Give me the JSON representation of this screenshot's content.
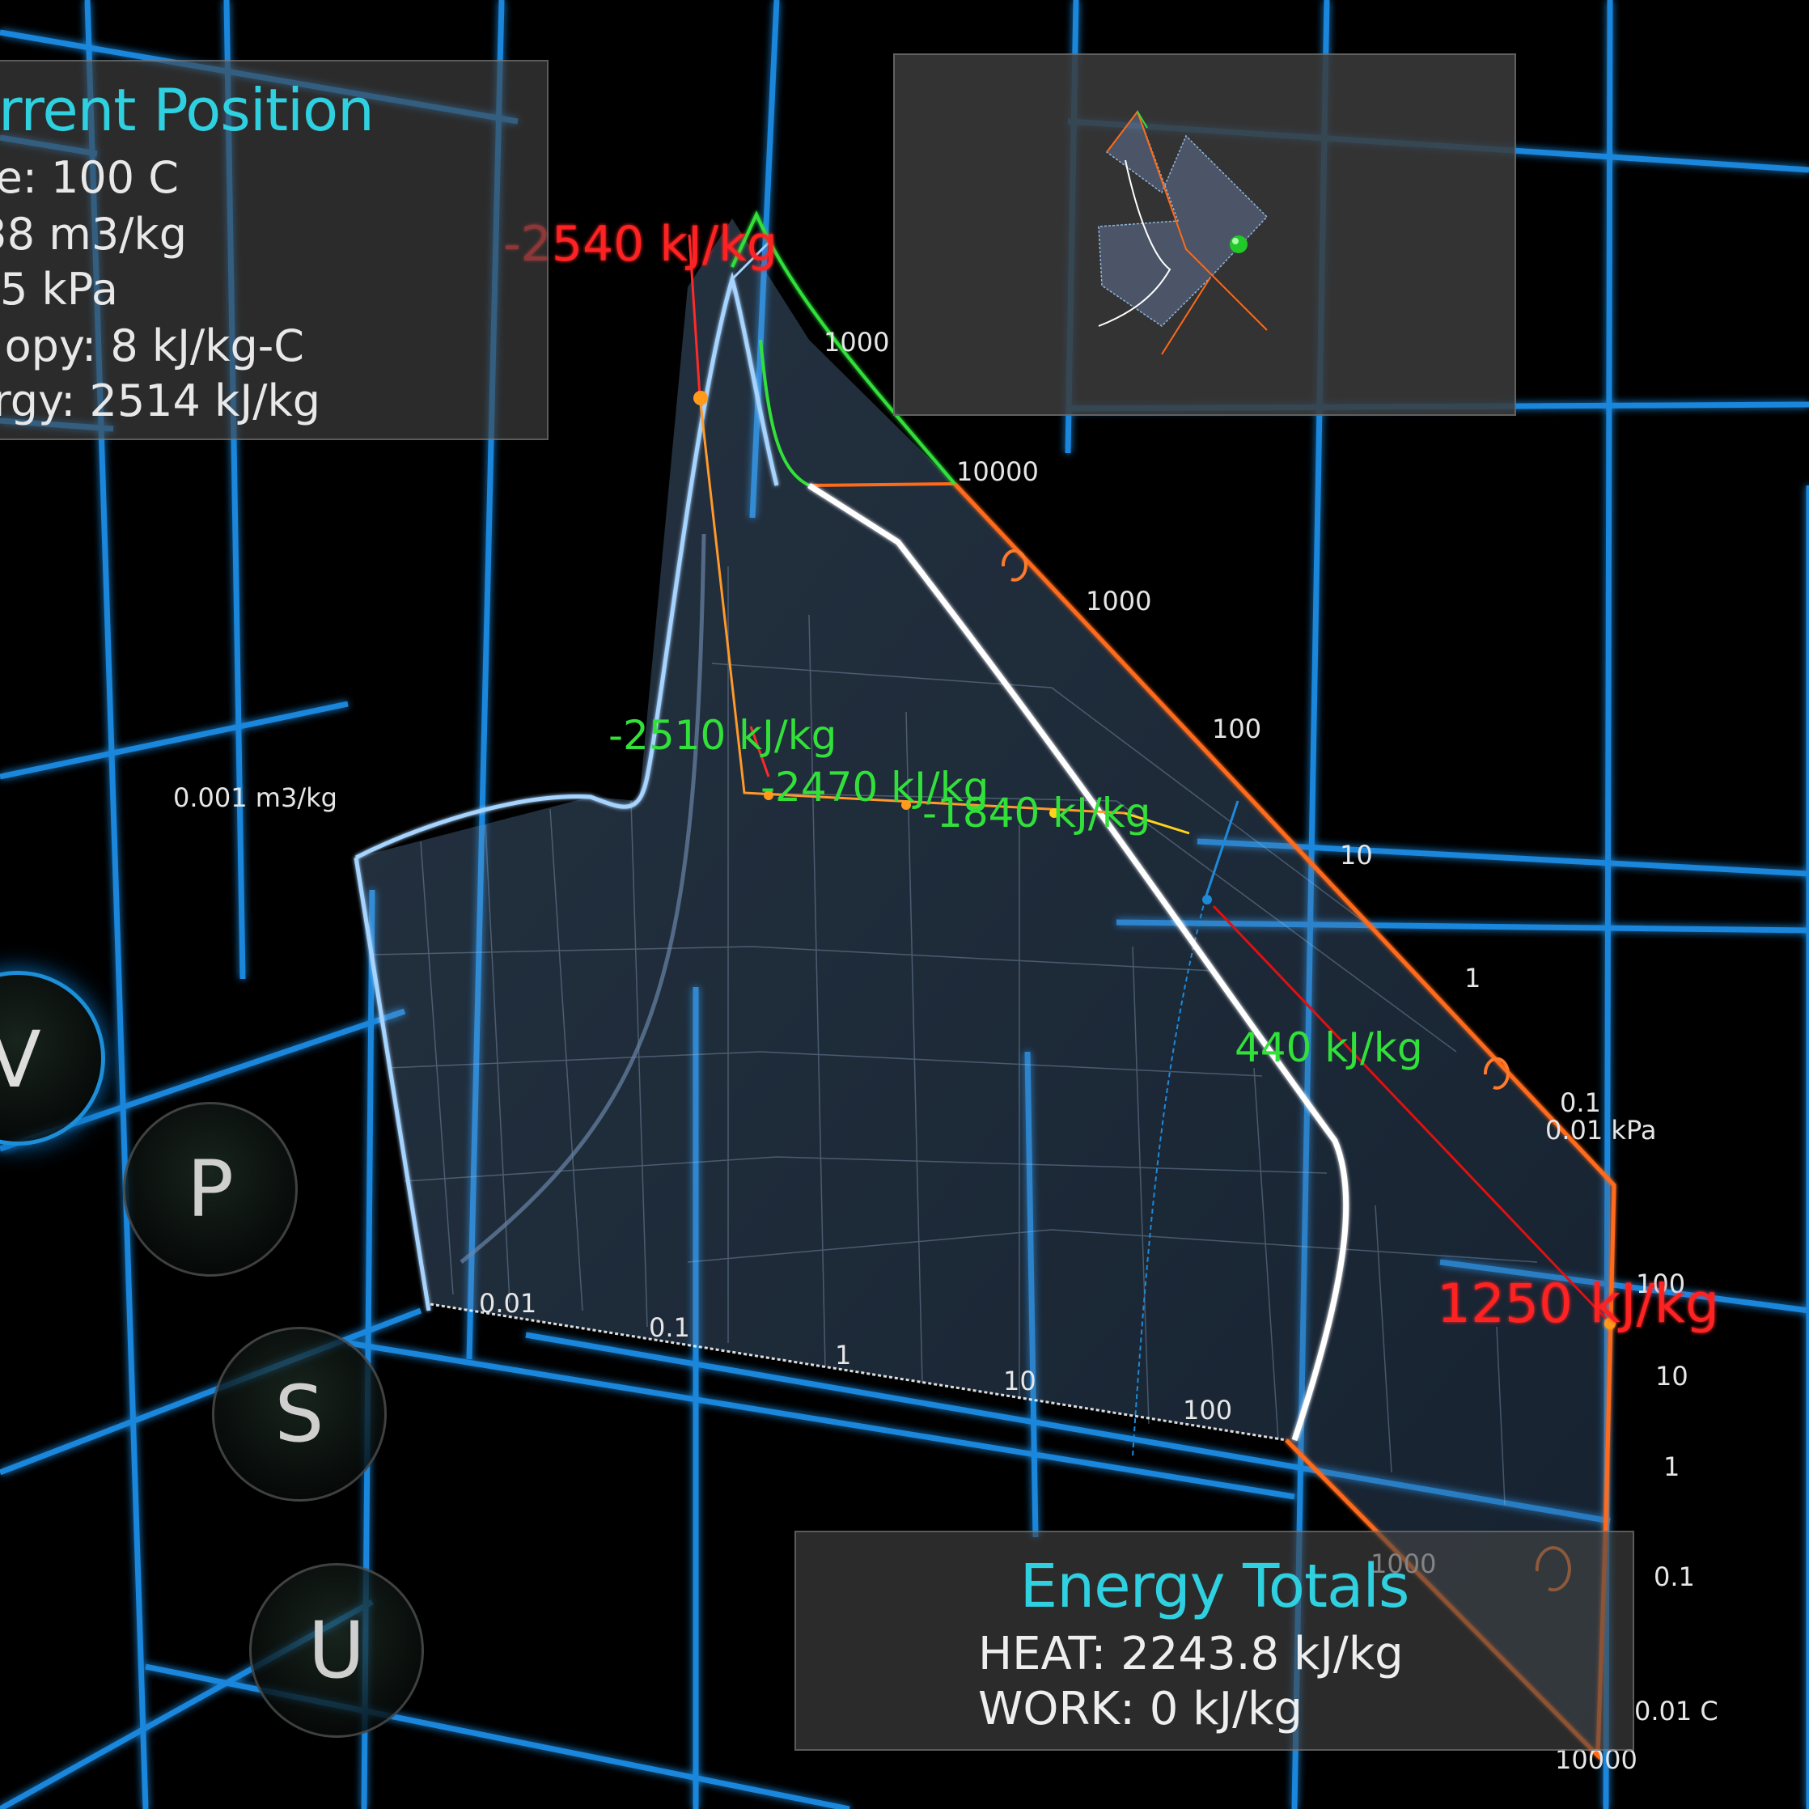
{
  "current_position": {
    "title": "rrent Position",
    "lines": [
      "e: 100 C",
      "38 m3/kg",
      "5 kPa",
      "opy: 8 kJ/kg-C",
      "rgy: 2514 kJ/kg"
    ]
  },
  "energy_totals": {
    "title": "Energy Totals",
    "heat": "HEAT: 2243.8 kJ/kg",
    "work": "WORK: 0 kJ/kg"
  },
  "mode_buttons": [
    "V",
    "P",
    "S",
    "U"
  ],
  "active_mode": "V",
  "energy_labels": {
    "red_top": "-2540 kJ/kg",
    "red_right": "1250 kJ/kg",
    "green_1": "-2510 kJ/kg",
    "green_2": "-2470 kJ/kg",
    "green_3": "-1840 kJ/kg",
    "green_4": "440 kJ/kg"
  },
  "axis_labels": {
    "volume_unit": "0.001 m3/kg",
    "pressure_unit": "0.01 kPa",
    "temperature_unit": "0.01 C",
    "pressure_ticks": [
      "1000",
      "10000",
      "1000",
      "100",
      "10",
      "1",
      "0.1"
    ],
    "volume_ticks": [
      "0.01",
      "0.1",
      "1",
      "10",
      "100",
      "1000"
    ],
    "temperature_ticks": [
      "100",
      "10",
      "1",
      "0.1",
      "10000"
    ]
  },
  "colors": {
    "grid": "#1a8fe8",
    "accent": "#2fd0e0",
    "surface": "#8fb6dc",
    "orange": "#ff6a1a",
    "green": "#32e03a",
    "red": "#ff2a2a"
  }
}
